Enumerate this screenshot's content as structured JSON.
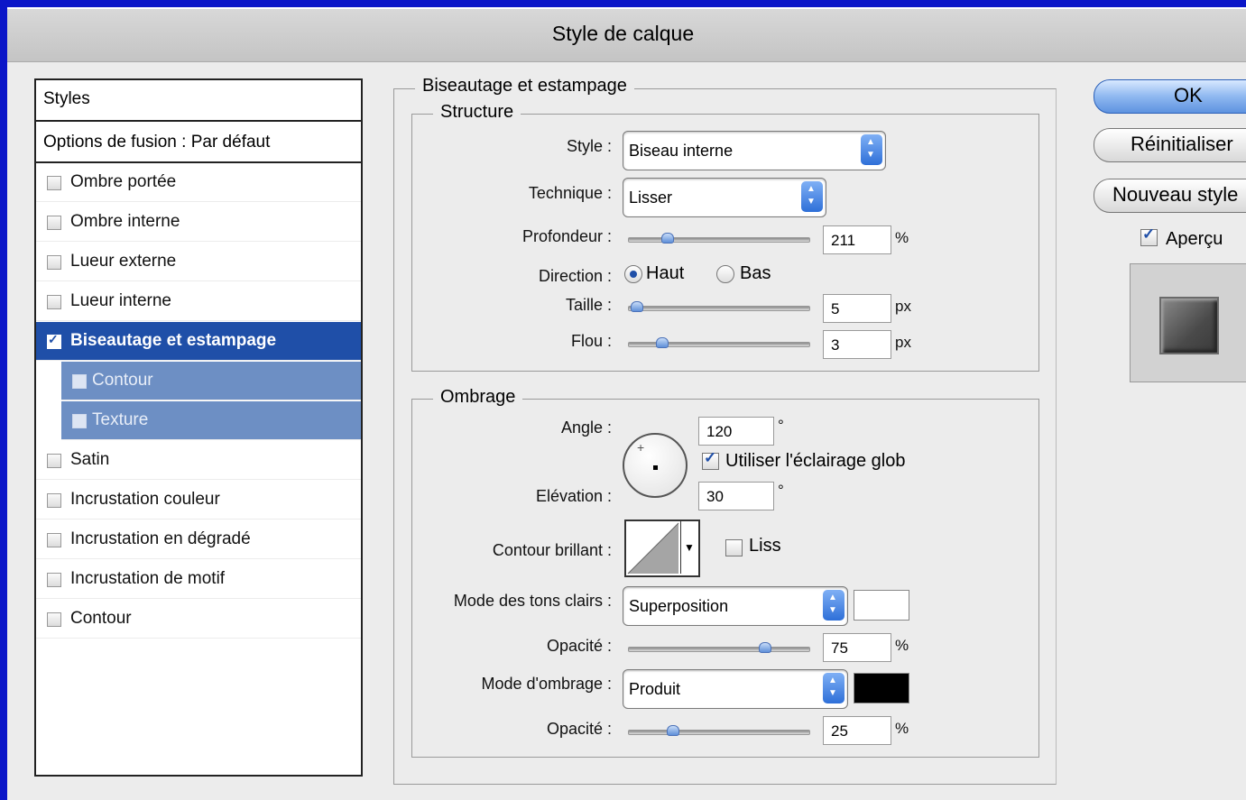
{
  "window": {
    "title": "Style de calque"
  },
  "styles_list": {
    "header": "Styles",
    "blend_options": "Options de fusion : Par défaut",
    "items": [
      {
        "label": "Ombre portée",
        "checked": false
      },
      {
        "label": "Ombre interne",
        "checked": false
      },
      {
        "label": "Lueur externe",
        "checked": false
      },
      {
        "label": "Lueur interne",
        "checked": false
      },
      {
        "label": "Biseautage et estampage",
        "checked": true,
        "selected": true
      },
      {
        "label": "Contour",
        "checked": false,
        "sub": true
      },
      {
        "label": "Texture",
        "checked": false,
        "sub": true
      },
      {
        "label": "Satin",
        "checked": false
      },
      {
        "label": "Incrustation couleur",
        "checked": false
      },
      {
        "label": "Incrustation en dégradé",
        "checked": false
      },
      {
        "label": "Incrustation de motif",
        "checked": false
      },
      {
        "label": "Contour",
        "checked": false
      }
    ]
  },
  "bevel": {
    "title": "Biseautage et estampage",
    "structure": {
      "title": "Structure",
      "style_label": "Style :",
      "style_value": "Biseau interne",
      "technique_label": "Technique :",
      "technique_value": "Lisser",
      "depth_label": "Profondeur :",
      "depth_value": "211",
      "depth_unit": "%",
      "direction_label": "Direction :",
      "direction_up": "Haut",
      "direction_down": "Bas",
      "size_label": "Taille :",
      "size_value": "5",
      "size_unit": "px",
      "soften_label": "Flou :",
      "soften_value": "3",
      "soften_unit": "px"
    },
    "shading": {
      "title": "Ombrage",
      "angle_label": "Angle :",
      "angle_value": "120",
      "angle_unit": "°",
      "global_light_label": "Utiliser l'éclairage glob",
      "altitude_label": "Elévation :",
      "altitude_value": "30",
      "altitude_unit": "°",
      "gloss_label": "Contour brillant :",
      "antialias_label": "Liss",
      "highlight_label": "Mode des tons clairs :",
      "highlight_value": "Superposition",
      "highlight_color": "#ffffff",
      "hl_opacity_label": "Opacité :",
      "hl_opacity_value": "75",
      "hl_opacity_unit": "%",
      "shadow_label": "Mode d'ombrage :",
      "shadow_value": "Produit",
      "shadow_color": "#000000",
      "sh_opacity_label": "Opacité :",
      "sh_opacity_value": "25",
      "sh_opacity_unit": "%"
    }
  },
  "buttons": {
    "ok": "OK",
    "reset": "Réinitialiser",
    "new_style": "Nouveau style",
    "preview": "Aperçu"
  }
}
